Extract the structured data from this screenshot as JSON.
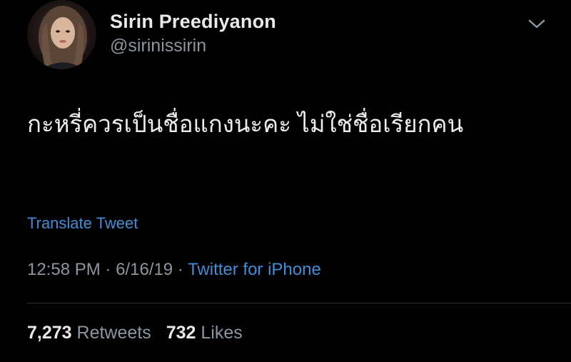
{
  "author": {
    "display_name": "Sirin Preediyanon",
    "handle": "@sirinissirin"
  },
  "tweet": {
    "text": "กะหรี่ควรเป็นชื่อแกงนะคะ ไม่ใช่ชื่อเรียกคน",
    "translate_label": "Translate Tweet",
    "time": "12:58 PM",
    "date": "6/16/19",
    "separator": "·",
    "source": "Twitter for iPhone"
  },
  "stats": {
    "retweets_count": "7,273",
    "retweets_label": "Retweets",
    "likes_count": "732",
    "likes_label": "Likes"
  },
  "icons": {
    "menu": "chevron-down-icon",
    "avatar": "avatar"
  },
  "colors": {
    "background": "#000000",
    "link": "#3f8ed8",
    "secondary_text": "#8b96a1",
    "primary_text": "#e9e9e9"
  }
}
